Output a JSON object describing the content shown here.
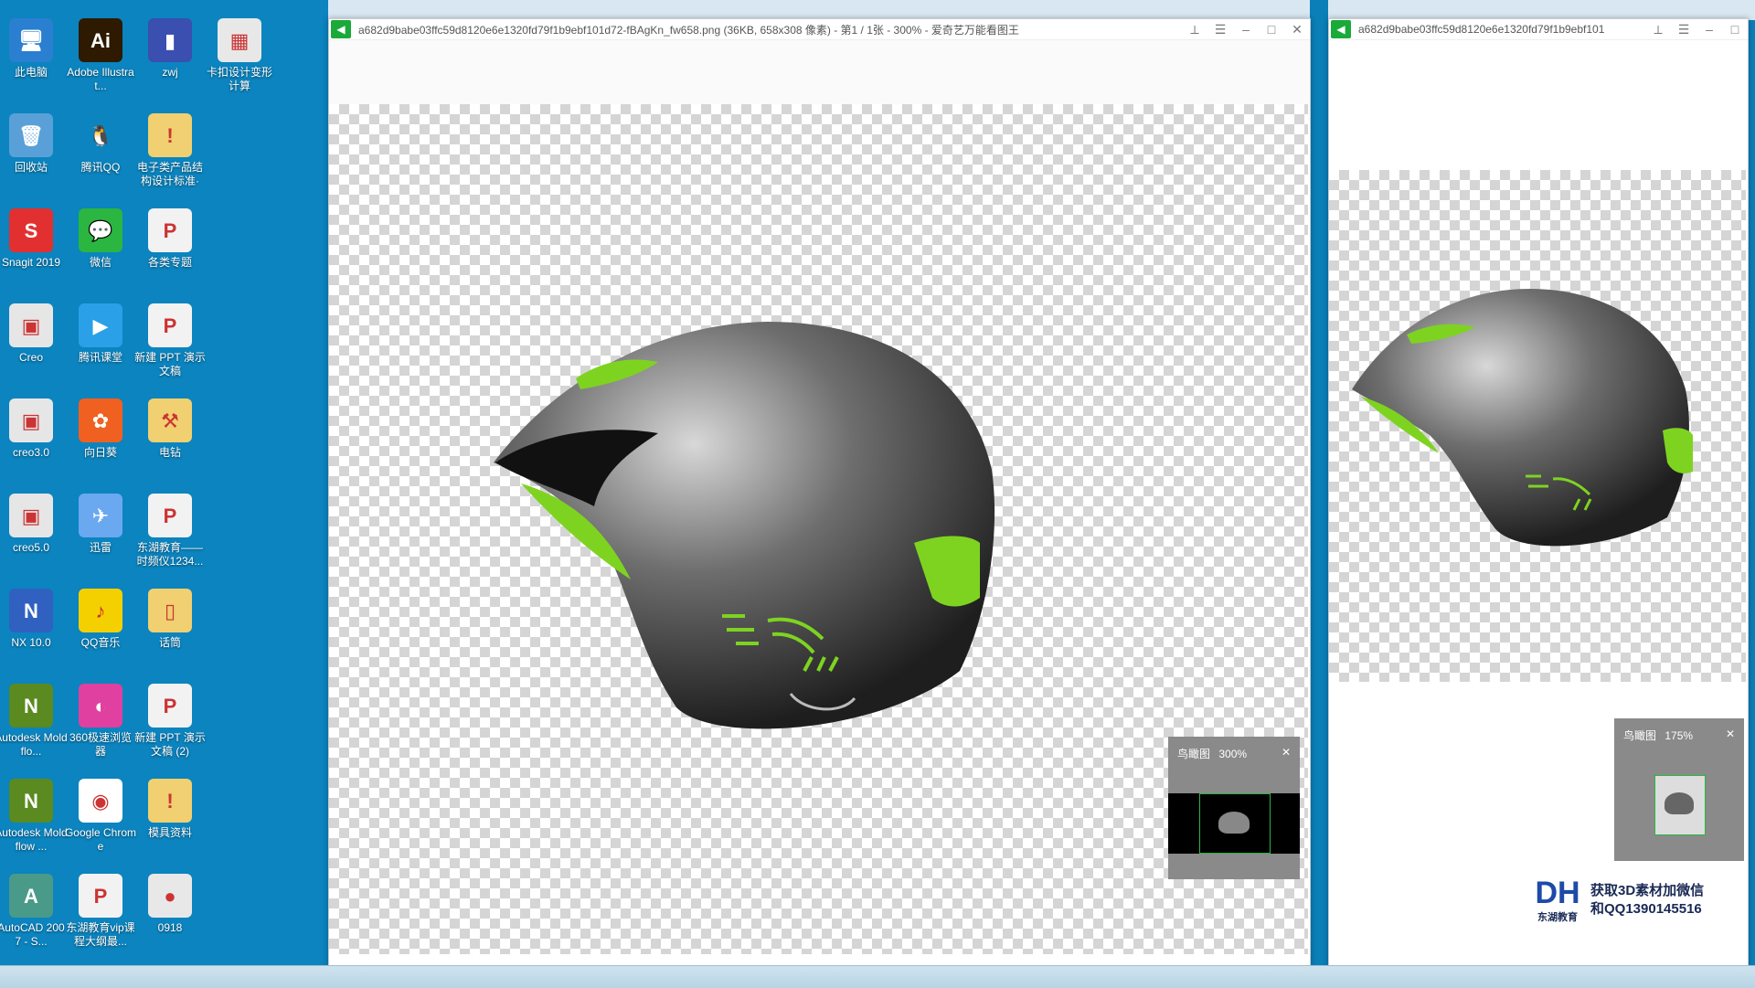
{
  "desktop": {
    "icons": [
      {
        "label": "此电脑",
        "glyph": "🖥",
        "bg": "#2a7fd0"
      },
      {
        "label": "Adobe Illustrat...",
        "glyph": "Ai",
        "bg": "#2d1a00"
      },
      {
        "label": "zwj",
        "glyph": "▮",
        "bg": "#3a4fb0"
      },
      {
        "label": "卡扣设计变形计算",
        "glyph": "▦",
        "bg": "#e8e8e8"
      },
      {
        "label": "回收站",
        "glyph": "🗑",
        "bg": "#5aa0d8"
      },
      {
        "label": "腾讯QQ",
        "glyph": "🐧",
        "bg": "#0b84bf"
      },
      {
        "label": "电子类产品结构设计标准·",
        "glyph": "!",
        "bg": "#f0d070"
      },
      {
        "label": "Snagit 2019",
        "glyph": "S",
        "bg": "#e23030"
      },
      {
        "label": "微信",
        "glyph": "💬",
        "bg": "#2ab640"
      },
      {
        "label": "各类专题",
        "glyph": "P",
        "bg": "#f2f2f2"
      },
      {
        "label": "Creo",
        "glyph": "▣",
        "bg": "#e6e6e6"
      },
      {
        "label": "腾讯课堂",
        "glyph": "▶",
        "bg": "#2aa0e8"
      },
      {
        "label": "新建 PPT 演示文稿",
        "glyph": "P",
        "bg": "#f2f2f2"
      },
      {
        "label": "creo3.0",
        "glyph": "▣",
        "bg": "#e6e6e6"
      },
      {
        "label": "向日葵",
        "glyph": "✿",
        "bg": "#f06020"
      },
      {
        "label": "电钻",
        "glyph": "⚒",
        "bg": "#f0d070"
      },
      {
        "label": "creo5.0",
        "glyph": "▣",
        "bg": "#e6e6e6"
      },
      {
        "label": "迅雷",
        "glyph": "✈",
        "bg": "#6aa8f0"
      },
      {
        "label": "东湖教育——时频仪1234...",
        "glyph": "P",
        "bg": "#f2f2f2"
      },
      {
        "label": "NX 10.0",
        "glyph": "N",
        "bg": "#3060c0"
      },
      {
        "label": "QQ音乐",
        "glyph": "♪",
        "bg": "#f5d000"
      },
      {
        "label": "话筒",
        "glyph": "▯",
        "bg": "#f0d070"
      },
      {
        "label": "Autodesk Moldflo...",
        "glyph": "N",
        "bg": "#5a8a20"
      },
      {
        "label": "360极速浏览器",
        "glyph": "◐",
        "bg": "#e040a0"
      },
      {
        "label": "新建 PPT 演示文稿 (2)",
        "glyph": "P",
        "bg": "#f2f2f2"
      },
      {
        "label": "Autodesk Moldflow ...",
        "glyph": "N",
        "bg": "#5a8a20"
      },
      {
        "label": "Google Chrome",
        "glyph": "◉",
        "bg": "#ffffff"
      },
      {
        "label": "模具资料",
        "glyph": "!",
        "bg": "#f0d070"
      },
      {
        "label": "AutoCAD 2007 - S...",
        "glyph": "A",
        "bg": "#4a9a8a"
      },
      {
        "label": "东湖教育vip课程大纲最...",
        "glyph": "P",
        "bg": "#f2f2f2"
      },
      {
        "label": "0918",
        "glyph": "●",
        "bg": "#e8e8e8"
      }
    ]
  },
  "viewer_main": {
    "title": "a682d9babe03ffc59d8120e6e1320fd79f1b9ebf101d72-fBAgKn_fw658.png (36KB, 658x308 像素) - 第1 / 1张 - 300% - 爱奇艺万能看图王",
    "navigator_label": "鸟瞰图",
    "zoom": "300%"
  },
  "viewer_second": {
    "title": "a682d9babe03ffc59d8120e6e1320fd79f1b9ebf101",
    "navigator_label": "鸟瞰图",
    "zoom": "175%"
  },
  "watermark": {
    "logo_text": "东湖教育",
    "line1": "获取3D素材加微信",
    "line2": "和QQ1390145516"
  }
}
